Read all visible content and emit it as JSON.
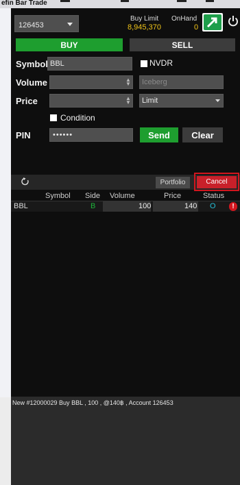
{
  "window": {
    "title": "efin Bar Trade"
  },
  "account": {
    "number": "126453"
  },
  "buy_limit": {
    "label": "Buy Limit",
    "value": "8,945,370"
  },
  "onhand": {
    "label": "OnHand",
    "value": "0"
  },
  "tabs": {
    "buy": "BUY",
    "sell": "SELL"
  },
  "form": {
    "symbol_label": "Symbol",
    "symbol_value": "BBL",
    "nvdr_label": "NVDR",
    "volume_label": "Volume",
    "volume_value": "",
    "iceberg_placeholder": "Iceberg",
    "price_label": "Price",
    "price_value": "",
    "price_type": "Limit",
    "condition_label": "Condition",
    "pin_label": "PIN",
    "pin_value": "••••••",
    "send_label": "Send",
    "clear_label": "Clear"
  },
  "orders_toolbar": {
    "portfolio_label": "Portfolio",
    "cancel_label": "Cancel"
  },
  "orders_table": {
    "columns": [
      "Symbol",
      "Side",
      "Volume",
      "Price",
      "Status"
    ],
    "rows": [
      {
        "symbol": "BBL",
        "side": "B",
        "volume": "100",
        "price": "140",
        "status": "O"
      }
    ]
  },
  "message": "New #12000029  Buy  BBL , 100 , @140฿ , Account 126453",
  "colors": {
    "buy_green": "#1e9e2f",
    "cancel_red": "#c8202a",
    "value_gold": "#f0c419",
    "status_cyan": "#25c0d8",
    "logo_green": "#1e9e4a"
  }
}
